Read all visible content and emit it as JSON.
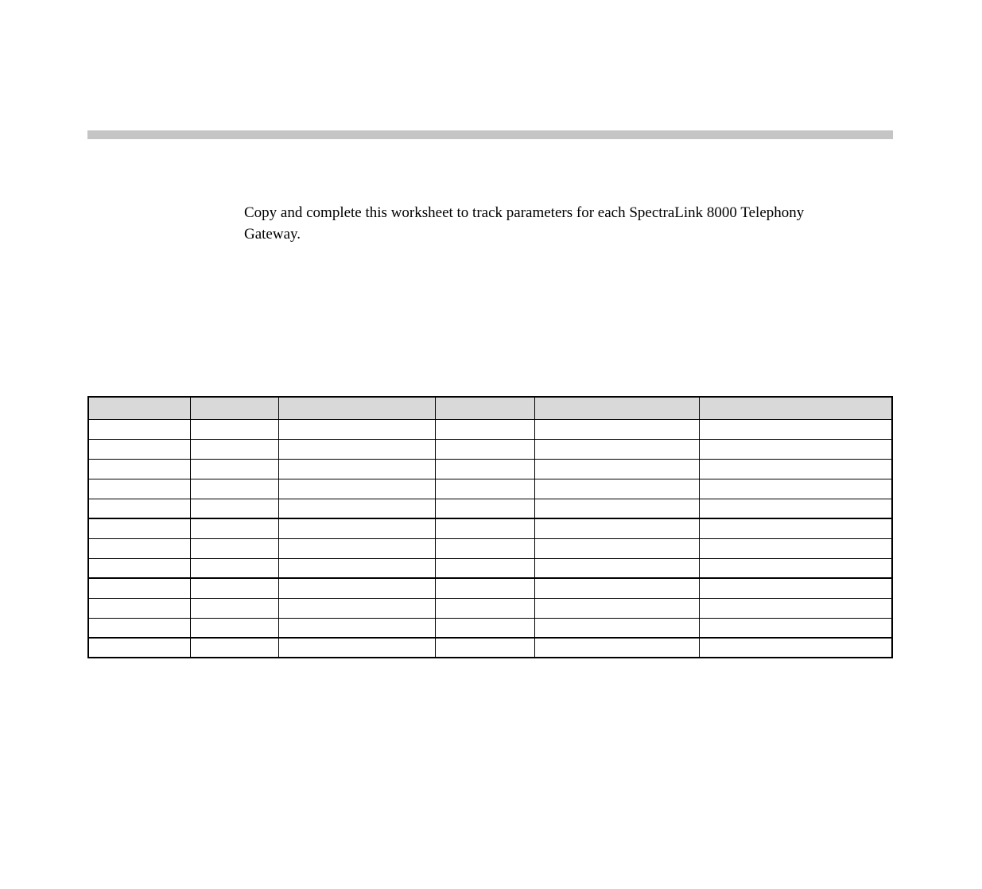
{
  "intro": "Copy and complete this worksheet to track parameters for each SpectraLink 8000 Telephony Gateway.",
  "table": {
    "headers": [
      "",
      "",
      "",
      "",
      "",
      ""
    ],
    "rows": [
      [
        "",
        "",
        "",
        "",
        "",
        ""
      ],
      [
        "",
        "",
        "",
        "",
        "",
        ""
      ],
      [
        "",
        "",
        "",
        "",
        "",
        ""
      ],
      [
        "",
        "",
        "",
        "",
        "",
        ""
      ],
      [
        "",
        "",
        "",
        "",
        "",
        ""
      ],
      [
        "",
        "",
        "",
        "",
        "",
        ""
      ],
      [
        "",
        "",
        "",
        "",
        "",
        ""
      ],
      [
        "",
        "",
        "",
        "",
        "",
        ""
      ],
      [
        "",
        "",
        "",
        "",
        "",
        ""
      ],
      [
        "",
        "",
        "",
        "",
        "",
        ""
      ],
      [
        "",
        "",
        "",
        "",
        "",
        ""
      ],
      [
        "",
        "",
        "",
        "",
        "",
        ""
      ]
    ]
  }
}
